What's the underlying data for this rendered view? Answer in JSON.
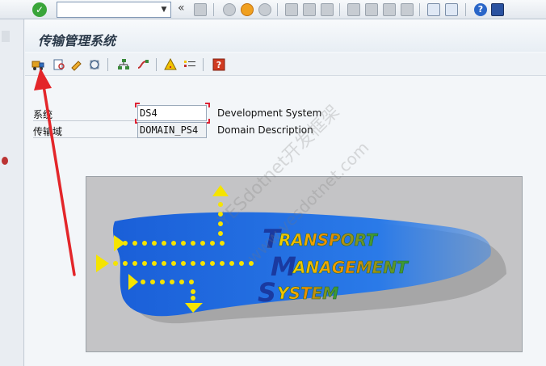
{
  "system_toolbar": {
    "command_field_value": "",
    "back_chevron": "«"
  },
  "window": {
    "title": "传输管理系统"
  },
  "form": {
    "system_label": "系统",
    "system_value": "DS4",
    "system_description": "Development System",
    "domain_label": "传输域",
    "domain_value": "DOMAIN_PS4",
    "domain_description": "Domain Description"
  },
  "logo": {
    "line1_initial": "T",
    "line1_rest": "RANSPORT",
    "line2_initial": "M",
    "line2_rest": "ANAGEMENT",
    "line3_initial": "S",
    "line3_rest": "YSTEM"
  },
  "watermark": {
    "line1": "YESdotnet开发框架",
    "line2": "www.yesdotnet.com"
  },
  "colors": {
    "brush_blue": "#1f6fe0",
    "arrow_yellow": "#f5e400",
    "annotation_red": "#e3262a"
  }
}
